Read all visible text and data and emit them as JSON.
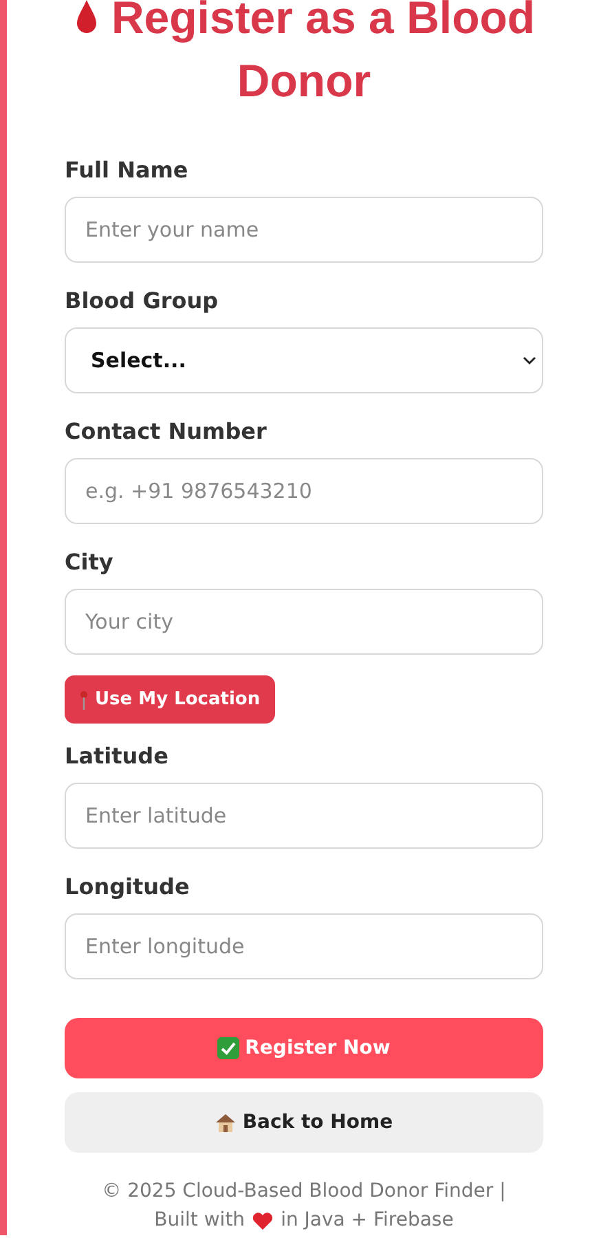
{
  "title": "Register as a Blood Donor",
  "form_items": [
    {
      "kind": "input",
      "label": "Full Name",
      "placeholder": "Enter your name"
    },
    {
      "kind": "select",
      "label": "Blood Group",
      "value": "Select..."
    },
    {
      "kind": "input",
      "label": "Contact Number",
      "placeholder": "e.g. +91 9876543210"
    },
    {
      "kind": "input",
      "label": "City",
      "placeholder": "Your city"
    },
    {
      "kind": "location_button",
      "label": "Use My Location"
    },
    {
      "kind": "input",
      "label": "Latitude",
      "placeholder": "Enter latitude"
    },
    {
      "kind": "input",
      "label": "Longitude",
      "placeholder": "Enter longitude"
    }
  ],
  "buttons": [
    {
      "kind": "primary",
      "label": "Register Now"
    },
    {
      "kind": "secondary",
      "label": "Back to Home"
    }
  ],
  "footer": {
    "line_1": "© 2025 Cloud-Based Blood Donor Finder |",
    "before_icon": "Built with",
    "after_icon": "in Java + Firebase"
  }
}
